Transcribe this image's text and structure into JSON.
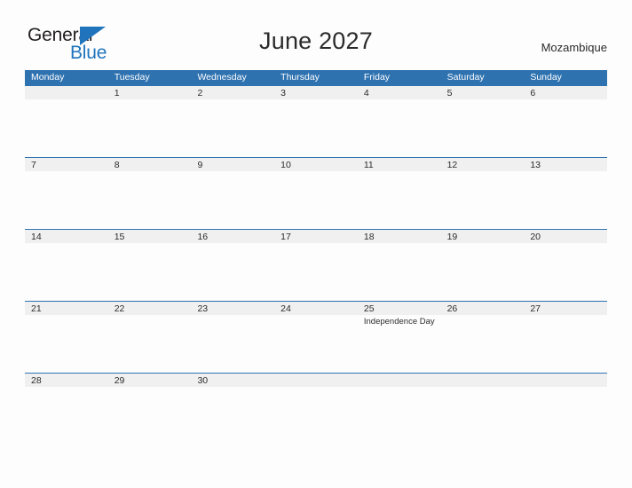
{
  "header": {
    "logo": {
      "word_one": "General",
      "word_two": "Blue",
      "flag_icon": "blue-triangle-flag-icon",
      "color_dark": "#231f20",
      "color_blue": "#1f74bc"
    },
    "title": "June 2027",
    "country": "Mozambique"
  },
  "calendar": {
    "accent_color": "#2e72b0",
    "band_color": "#f0f0f0",
    "weekdays": [
      "Monday",
      "Tuesday",
      "Wednesday",
      "Thursday",
      "Friday",
      "Saturday",
      "Sunday"
    ],
    "weeks": [
      [
        {
          "day": ""
        },
        {
          "day": "1"
        },
        {
          "day": "2"
        },
        {
          "day": "3"
        },
        {
          "day": "4"
        },
        {
          "day": "5"
        },
        {
          "day": "6"
        }
      ],
      [
        {
          "day": "7"
        },
        {
          "day": "8"
        },
        {
          "day": "9"
        },
        {
          "day": "10"
        },
        {
          "day": "11"
        },
        {
          "day": "12"
        },
        {
          "day": "13"
        }
      ],
      [
        {
          "day": "14"
        },
        {
          "day": "15"
        },
        {
          "day": "16"
        },
        {
          "day": "17"
        },
        {
          "day": "18"
        },
        {
          "day": "19"
        },
        {
          "day": "20"
        }
      ],
      [
        {
          "day": "21"
        },
        {
          "day": "22"
        },
        {
          "day": "23"
        },
        {
          "day": "24"
        },
        {
          "day": "25",
          "event": "Independence Day"
        },
        {
          "day": "26"
        },
        {
          "day": "27"
        }
      ],
      [
        {
          "day": "28"
        },
        {
          "day": "29"
        },
        {
          "day": "30"
        },
        {
          "day": ""
        },
        {
          "day": ""
        },
        {
          "day": ""
        },
        {
          "day": ""
        }
      ]
    ]
  }
}
